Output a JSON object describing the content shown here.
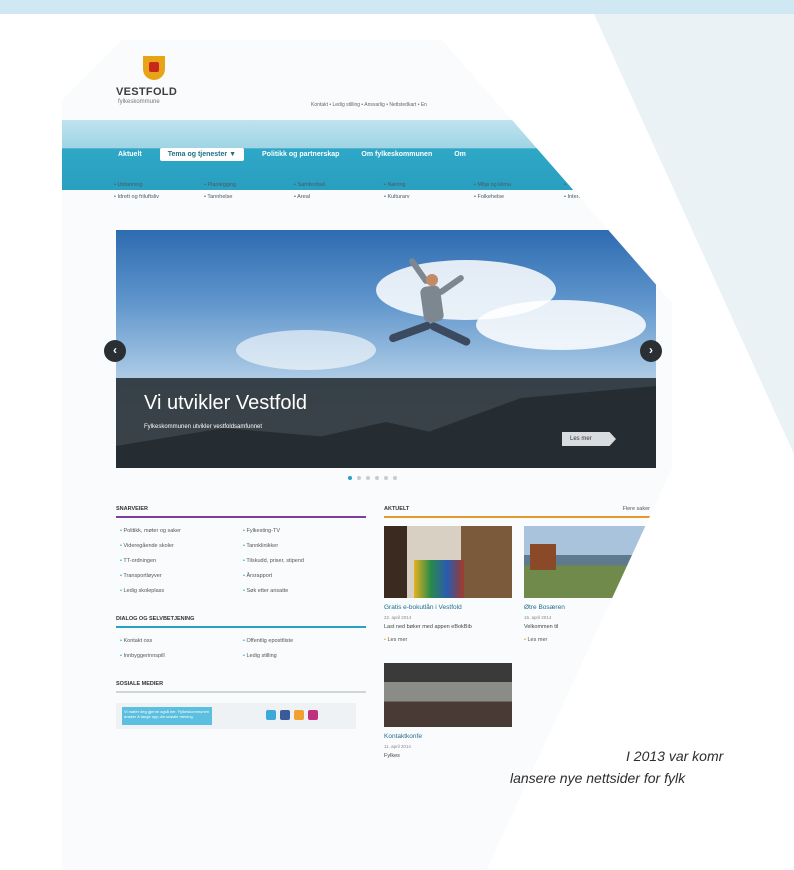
{
  "site": {
    "logo_name": "VESTFOLD",
    "logo_sub": "fylkeskommune",
    "top_links": "Kontakt • Ledig stilling • Ansvarlig • Nettstedkart • En"
  },
  "nav": {
    "items": [
      "Aktuelt",
      "Tema og tjenester ▼",
      "Politikk og partnerskap",
      "Om fylkeskommunen",
      "Om"
    ]
  },
  "subnav": {
    "row1": [
      "• Utdanning",
      "• Planlegging",
      "• Samferdsel",
      "• Næring",
      "• Miljø og klima",
      "• "
    ],
    "row2": [
      "• Idrett og friluftsliv",
      "• Tannhelse",
      "• Areal",
      "• Kulturarv",
      "• Folkehelse",
      "• Intern"
    ]
  },
  "hero": {
    "title": "Vi utvikler Vestfold",
    "subtitle": "Fylkeskommunen utvikler vestfoldsamfunnet",
    "button": "Les mer",
    "prev": "‹",
    "next": "›"
  },
  "shortcuts": {
    "title": "SNARVEIER",
    "items": [
      "Politikk, møter og saker",
      "Fylkesting-TV",
      "Videregående skoler",
      "Tannklinikker",
      "TT-ordningen",
      "Tilskudd, priser, stipend",
      "Transportløyver",
      "Årsrapport",
      "Ledig skoleplass",
      "Søk etter ansatte"
    ]
  },
  "dialog": {
    "title": "DIALOG OG SELVBETJENING",
    "items": [
      "Kontakt oss",
      "Offentlig eposttliste",
      "Innbyggerinnspill",
      "Ledig stilling"
    ]
  },
  "social": {
    "title": "SOSIALE MEDIER",
    "text": "Vi møter deg gjerne også her. Fylkeskommunen ønsker å fange opp din sosiale mening"
  },
  "news": {
    "title": "AKTUELT",
    "all_link": "Flere saker",
    "cards": [
      {
        "title": "Gratis e-bokutlån i Vestfold",
        "date": "22. april 2014",
        "text": "Last ned bøker med appen eBokBib",
        "more": "Les mer"
      },
      {
        "title": "Øtre Bosæren",
        "date": "16. april 2014",
        "text": "Velkommen til",
        "more": "Les mer"
      }
    ],
    "card3_title": "Kontaktkonfe",
    "card3_date": "11. april 2014",
    "card3_text": "Fylkes"
  },
  "quote": {
    "line1": "I 2013 var komr",
    "line2": "lansere nye nettsider for fylk"
  },
  "colors": {
    "brand_teal": "#2aa0c4",
    "purple": "#7b3fa0",
    "orange": "#e39a2a"
  }
}
